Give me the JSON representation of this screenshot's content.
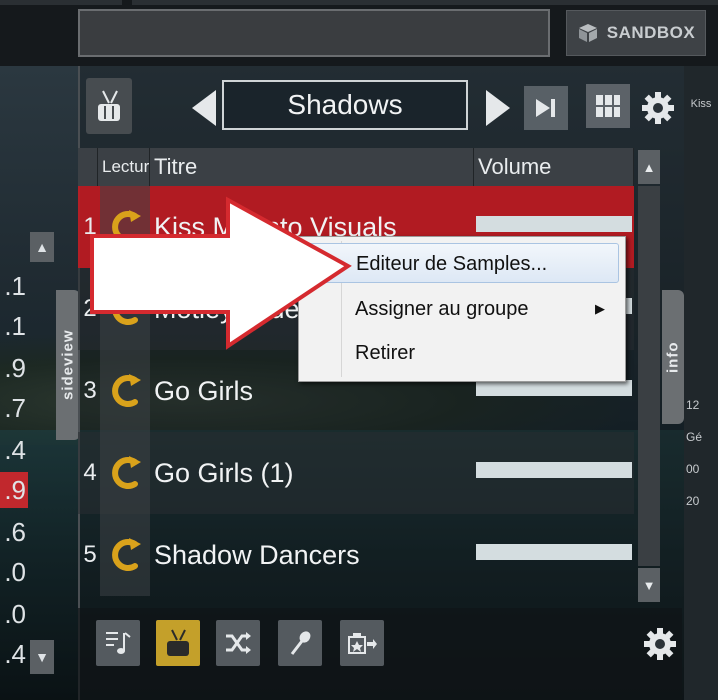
{
  "topbar": {
    "sandbox_label": "SANDBOX"
  },
  "left": {
    "values": [
      ".1",
      ".1",
      ".9",
      ".7",
      ".4",
      ".9",
      ".6",
      ".0",
      ".0",
      ".4"
    ],
    "sideview_label": "sideview"
  },
  "player": {
    "playlist_name": "Shadows"
  },
  "table": {
    "headers": {
      "lecture": "Lecture",
      "titre": "Titre",
      "volume": "Volume"
    },
    "rows": [
      {
        "num": "1",
        "title": "Kiss Me Into Visuals",
        "volume": 1.0
      },
      {
        "num": "2",
        "title": "Motley Crue",
        "volume": 1.0
      },
      {
        "num": "3",
        "title": "Go Girls",
        "volume": 1.0
      },
      {
        "num": "4",
        "title": "Go Girls (1)",
        "volume": 1.0
      },
      {
        "num": "5",
        "title": "Shadow Dancers",
        "volume": 1.0
      }
    ]
  },
  "context_menu": {
    "items": [
      "Editeur de Samples...",
      "Assigner au groupe",
      "Retirer"
    ]
  },
  "right": {
    "kiss_label": "Kiss",
    "info_label": "info",
    "values": [
      "12",
      "Gé",
      "00",
      "20"
    ]
  },
  "colors": {
    "selected_row": "#be1a22",
    "accent_gold": "#d9a21b",
    "active_tool": "#c4a02a"
  }
}
